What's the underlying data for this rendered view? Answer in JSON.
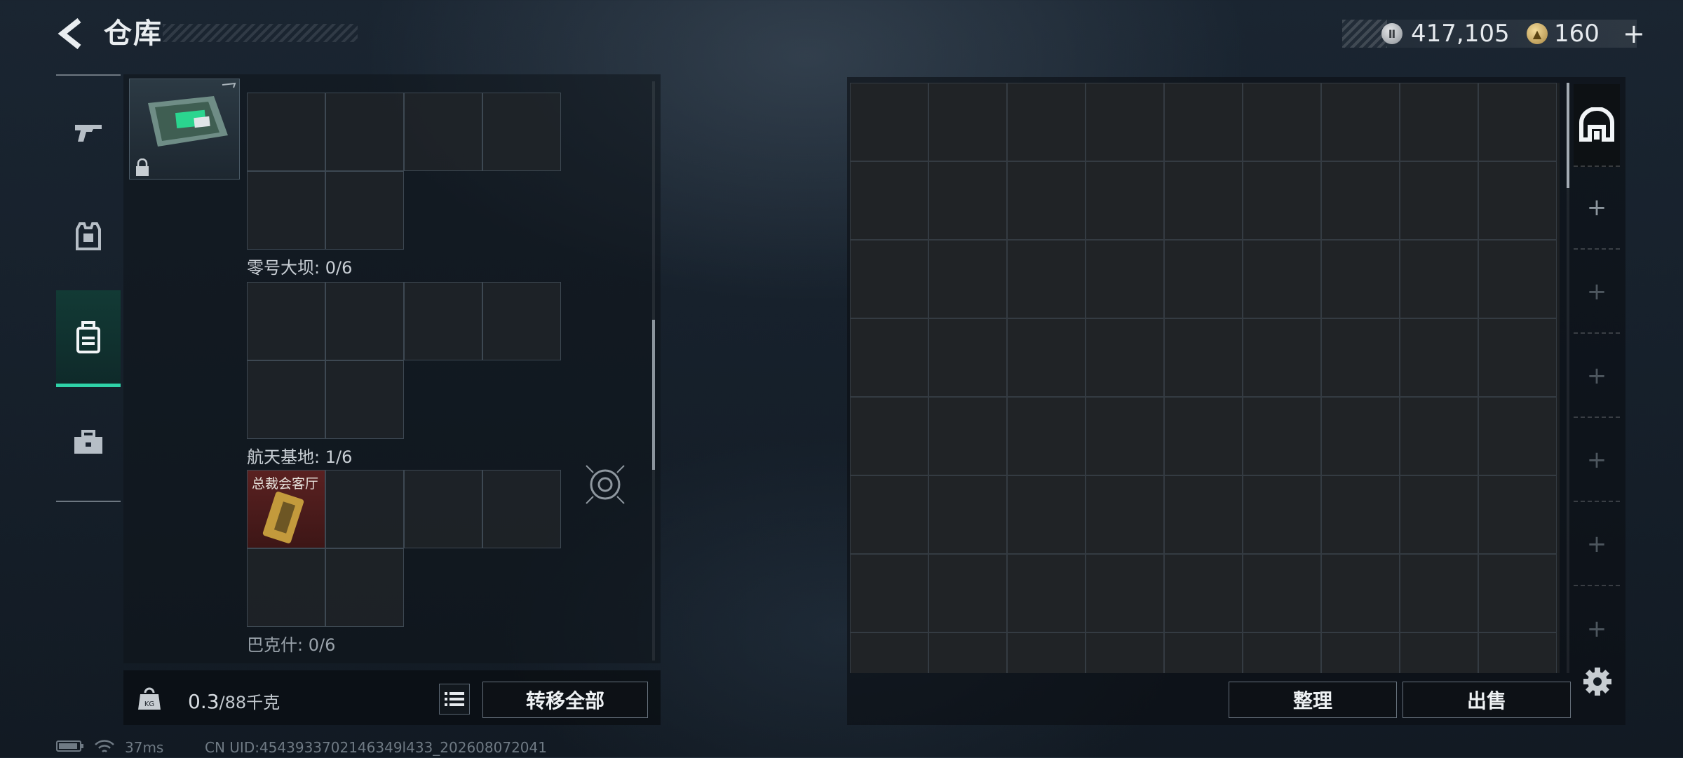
{
  "header": {
    "title": "仓库",
    "back_icon": "back-arrow-icon",
    "silver_amount": "417,105",
    "gold_amount": "160",
    "plus_label": "+"
  },
  "nav": {
    "items": [
      {
        "icon": "weapon-icon"
      },
      {
        "icon": "armor-vest-icon"
      },
      {
        "icon": "backpack-icon",
        "active": true
      },
      {
        "icon": "toolbox-icon"
      }
    ]
  },
  "storage": {
    "sections": [
      {
        "label": "零号大坝: 0/6"
      },
      {
        "label": "航天基地: 1/6"
      },
      {
        "label": "巴克什: 0/6"
      }
    ],
    "keycard_caption": "总裁会客厅"
  },
  "bottom_left": {
    "weight_value": "0.3",
    "weight_max": "/88千克",
    "weight_badge": "KG",
    "transfer_label": "转移全部"
  },
  "bottom_right": {
    "sort_label": "整理",
    "sell_label": "出售"
  },
  "status": {
    "ping": "37ms",
    "uid": "CN UID:4543933702146349l433_202608072041"
  },
  "colors": {
    "accent": "#2fd2a8",
    "keycard_bg": "#5a2121"
  }
}
